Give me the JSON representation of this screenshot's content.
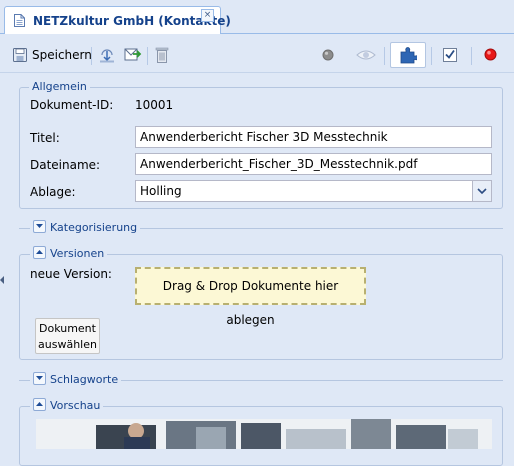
{
  "tab": {
    "title": "NETZkultur GmbH (Kontakte)",
    "close": "×",
    "icon": "document-icon"
  },
  "toolbar": {
    "save_label": "Speichern",
    "icons": [
      "save-icon",
      "download-icon",
      "export-icon",
      "trash-icon",
      "gray-dot-icon",
      "eye-icon",
      "puzzle-icon",
      "checkbox-icon",
      "red-dot-icon"
    ]
  },
  "allgemein": {
    "legend": "Allgemein",
    "doc_id_label": "Dokument-ID:",
    "doc_id_value": "10001",
    "titel_label": "Titel:",
    "titel_value": "Anwenderbericht Fischer 3D Messtechnik",
    "dateiname_label": "Dateiname:",
    "dateiname_value": "Anwenderbericht_Fischer_3D_Messtechnik.pdf",
    "ablage_label": "Ablage:",
    "ablage_value": "Holling"
  },
  "kategorisierung": {
    "legend": "Kategorisierung"
  },
  "versionen": {
    "legend": "Versionen",
    "neue_version_label": "neue Version:",
    "dropzone_text": "Drag & Drop Dokumente hier ablegen",
    "select_button_line1": "Dokument",
    "select_button_line2": "auswählen"
  },
  "schlagworte": {
    "legend": "Schlagworte"
  },
  "vorschau": {
    "legend": "Vorschau"
  },
  "colors": {
    "accent": "#15428b",
    "background": "#dfe8f6",
    "border": "#99bbe8",
    "dropzone": "#fcf8d5",
    "stop": "#e81818"
  }
}
